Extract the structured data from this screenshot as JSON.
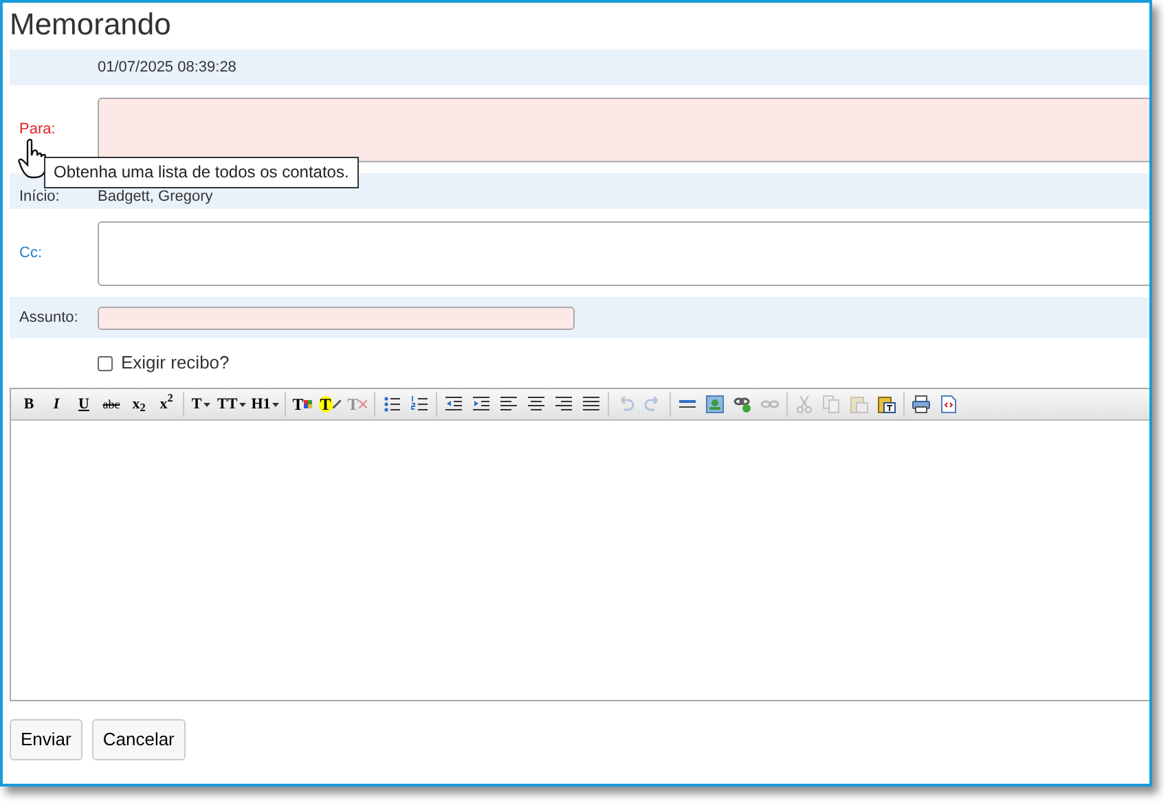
{
  "window": {
    "title": "Memorando"
  },
  "date": "01/07/2025 08:39:28",
  "to": {
    "label": "Para:",
    "required": true
  },
  "from": {
    "label": "Início:",
    "value": "Badgett, Gregory"
  },
  "cc": {
    "label": "Cc:",
    "required": false
  },
  "subject": {
    "label": "Assunto:",
    "required": true
  },
  "receipt": {
    "label": "Exigir recibo?",
    "checked": false
  },
  "tooltip": "Obtenha uma lista de todos os contatos.",
  "toolbar": [
    [
      {
        "kind": "format",
        "label": "B",
        "disabled": false
      },
      {
        "kind": "format",
        "label": "I",
        "disabled": false
      },
      {
        "kind": "format",
        "label": "U",
        "disabled": false
      },
      {
        "kind": "format",
        "label": "abc",
        "disabled": false
      },
      {
        "kind": "format",
        "label": "x$_{2}$",
        "disabled": false
      },
      {
        "kind": "format",
        "label": "x$^{2}$",
        "disabled": false
      }
    ],
    [
      {
        "kind": "dropdown",
        "label": "T",
        "disabled": false
      },
      {
        "kind": "dropdown",
        "label": "TT",
        "disabled": false
      },
      {
        "kind": "dropdown",
        "label": "H1",
        "disabled": false
      }
    ],
    [
      {
        "kind": "text-color",
        "label": "T",
        "disabled": false
      },
      {
        "kind": "highlight",
        "label": "T",
        "disabled": false
      },
      {
        "kind": "clear-format",
        "label": "T",
        "disabled": true
      }
    ],
    [
      {
        "kind": "bullet-list",
        "disabled": false
      },
      {
        "kind": "numbered-list",
        "disabled": false
      }
    ],
    [
      {
        "kind": "outdent",
        "disabled": false
      },
      {
        "kind": "indent",
        "disabled": false
      },
      {
        "kind": "align-left",
        "disabled": false
      },
      {
        "kind": "align-center",
        "disabled": false
      },
      {
        "kind": "align-right",
        "disabled": false
      },
      {
        "kind": "justify",
        "disabled": false
      }
    ],
    [
      {
        "kind": "undo",
        "disabled": true
      },
      {
        "kind": "redo",
        "disabled": true
      }
    ],
    [
      {
        "kind": "rule",
        "disabled": false
      },
      {
        "kind": "image",
        "disabled": false
      },
      {
        "kind": "link",
        "disabled": false
      },
      {
        "kind": "unlink",
        "disabled": true
      }
    ],
    [
      {
        "kind": "cut",
        "disabled": true
      },
      {
        "kind": "copy",
        "disabled": true
      },
      {
        "kind": "paste",
        "disabled": true
      },
      {
        "kind": "paste-text",
        "disabled": false
      }
    ],
    [
      {
        "kind": "print",
        "disabled": false
      },
      {
        "kind": "source",
        "disabled": false
      }
    ]
  ],
  "buttons": [
    "Enviar",
    "Cancelar"
  ]
}
